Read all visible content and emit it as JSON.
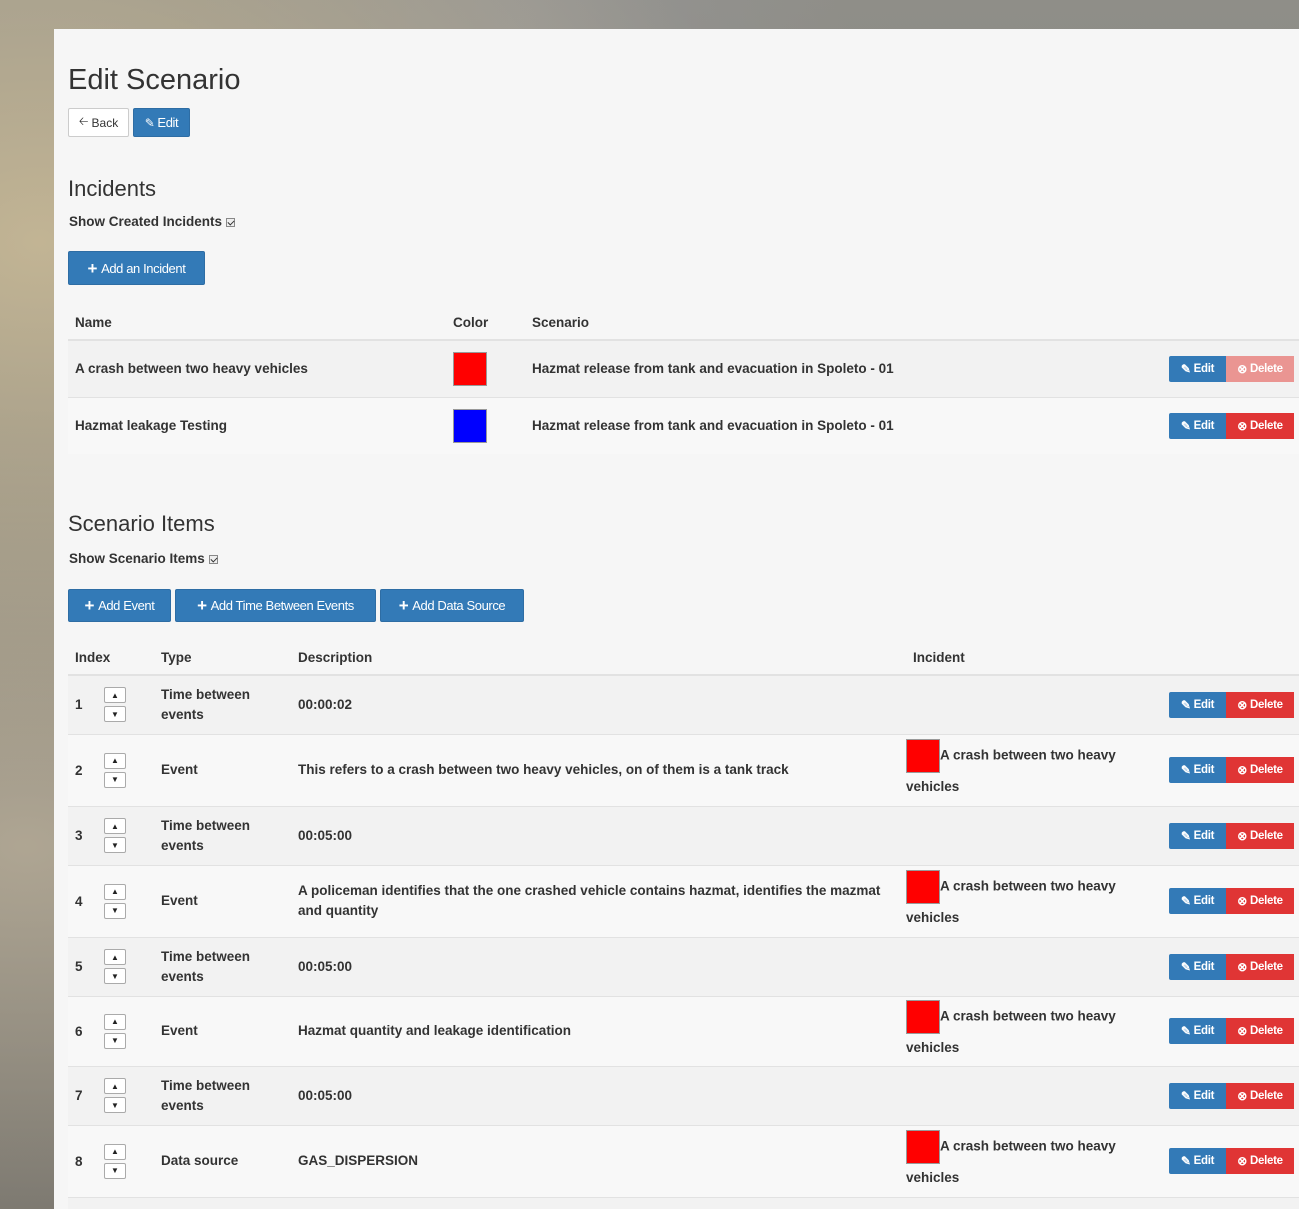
{
  "page": {
    "title": "Edit Scenario",
    "back_label": "Back",
    "edit_label": "Edit"
  },
  "incidents": {
    "heading": "Incidents",
    "show_label": "Show Created Incidents",
    "show_checked": true,
    "add_label": "Add an Incident",
    "columns": [
      "Name",
      "Color",
      "Scenario"
    ],
    "rows": [
      {
        "name": "A crash between two heavy vehicles",
        "color": "#ff0000",
        "scenario": "Hazmat release from tank and evacuation in Spoleto - 01",
        "edit": "Edit",
        "delete": "Delete"
      },
      {
        "name": "Hazmat leakage Testing",
        "color": "#0000ff",
        "scenario": "Hazmat release from tank and evacuation in Spoleto - 01",
        "edit": "Edit",
        "delete": "Delete"
      }
    ]
  },
  "items": {
    "heading": "Scenario Items",
    "show_label": "Show Scenario Items",
    "show_checked": true,
    "add_event_label": "Add Event",
    "add_time_label": "Add Time Between Events",
    "add_source_label": "Add Data Source",
    "columns": [
      "Index",
      "Type",
      "Description",
      "Incident"
    ],
    "rows": [
      {
        "index": "1",
        "type": "Time between events",
        "description": "00:00:02",
        "incident": "",
        "incident_color": "",
        "edit": "Edit",
        "delete": "Delete"
      },
      {
        "index": "2",
        "type": "Event",
        "description": "This refers to a crash between two heavy vehicles, on of them is a tank track",
        "incident": "A crash between two heavy vehicles",
        "incident_color": "#ff0000",
        "edit": "Edit",
        "delete": "Delete"
      },
      {
        "index": "3",
        "type": "Time between events",
        "description": "00:05:00",
        "incident": "",
        "incident_color": "",
        "edit": "Edit",
        "delete": "Delete"
      },
      {
        "index": "4",
        "type": "Event",
        "description": "A policeman identifies that the one crashed vehicle contains hazmat, identifies the mazmat and quantity",
        "incident": "A crash between two heavy vehicles",
        "incident_color": "#ff0000",
        "edit": "Edit",
        "delete": "Delete"
      },
      {
        "index": "5",
        "type": "Time between events",
        "description": "00:05:00",
        "incident": "",
        "incident_color": "",
        "edit": "Edit",
        "delete": "Delete"
      },
      {
        "index": "6",
        "type": "Event",
        "description": "Hazmat quantity and leakage identification",
        "incident": "A crash between two heavy vehicles",
        "incident_color": "#ff0000",
        "edit": "Edit",
        "delete": "Delete"
      },
      {
        "index": "7",
        "type": "Time between events",
        "description": "00:05:00",
        "incident": "",
        "incident_color": "",
        "edit": "Edit",
        "delete": "Delete"
      },
      {
        "index": "8",
        "type": "Data source",
        "description": "GAS_DISPERSION",
        "incident": "A crash between two heavy vehicles",
        "incident_color": "#ff0000",
        "edit": "Edit",
        "delete": "Delete"
      }
    ]
  },
  "icons": {
    "back": "arrow-left-icon",
    "edit": "edit-icon",
    "delete": "delete-circle-icon",
    "add": "plus-icon",
    "up": "caret-up-icon",
    "down": "caret-down-icon"
  },
  "colors": {
    "primary": "#337ab7",
    "danger": "#e03535"
  }
}
